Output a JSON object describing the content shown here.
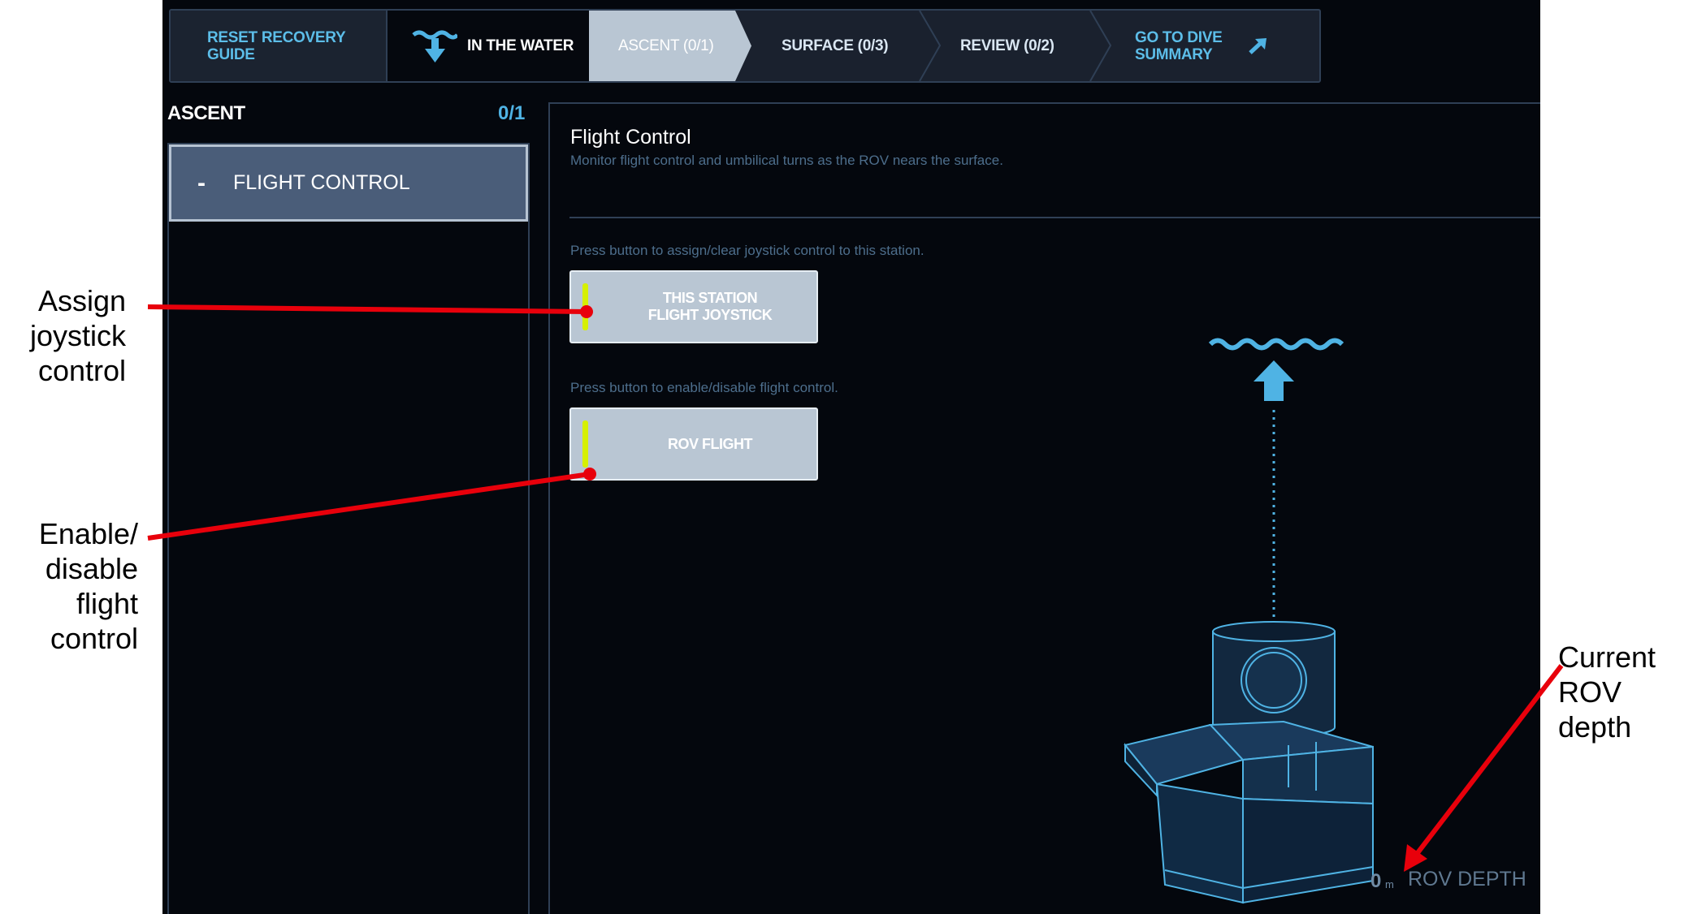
{
  "nav": {
    "reset_label": "RESET RECOVERY GUIDE",
    "in_water_label": "IN THE WATER",
    "ascent_label": "ASCENT (0/1)",
    "surface_label": "SURFACE (0/3)",
    "review_label": "REVIEW (0/2)",
    "dive_summary_label": "GO TO DIVE SUMMARY"
  },
  "sidebar": {
    "title": "ASCENT",
    "count": "0/1",
    "items": [
      {
        "label": "FLIGHT CONTROL",
        "expanded_marker": "-"
      }
    ]
  },
  "main": {
    "title": "Flight Control",
    "description": "Monitor flight control and umbilical turns as the ROV nears the surface.",
    "joystick": {
      "instruction": "Press button to assign/clear joystick control to this station.",
      "button_line1": "THIS STATION",
      "button_line2": "FLIGHT JOYSTICK"
    },
    "flight": {
      "instruction": "Press button to enable/disable flight control.",
      "button_label": "ROV FLIGHT"
    },
    "depth": {
      "value": "0",
      "unit": "m",
      "label": "ROV DEPTH"
    }
  },
  "annotations": {
    "assign": [
      "Assign",
      "joystick",
      "control"
    ],
    "enable": [
      "Enable/",
      "disable",
      "flight",
      "control"
    ],
    "depth": [
      "Current",
      "ROV",
      "depth"
    ]
  },
  "colors": {
    "background": "#04070d",
    "accent_blue": "#4fb3e4",
    "button_gray": "#b9c6d3",
    "indicator": "#d6f000",
    "annotation_red": "#e8000b"
  },
  "icons": [
    "dive-icon",
    "external-link-icon",
    "surface-wave-icon",
    "ascend-arrow-icon",
    "rov-icon"
  ]
}
